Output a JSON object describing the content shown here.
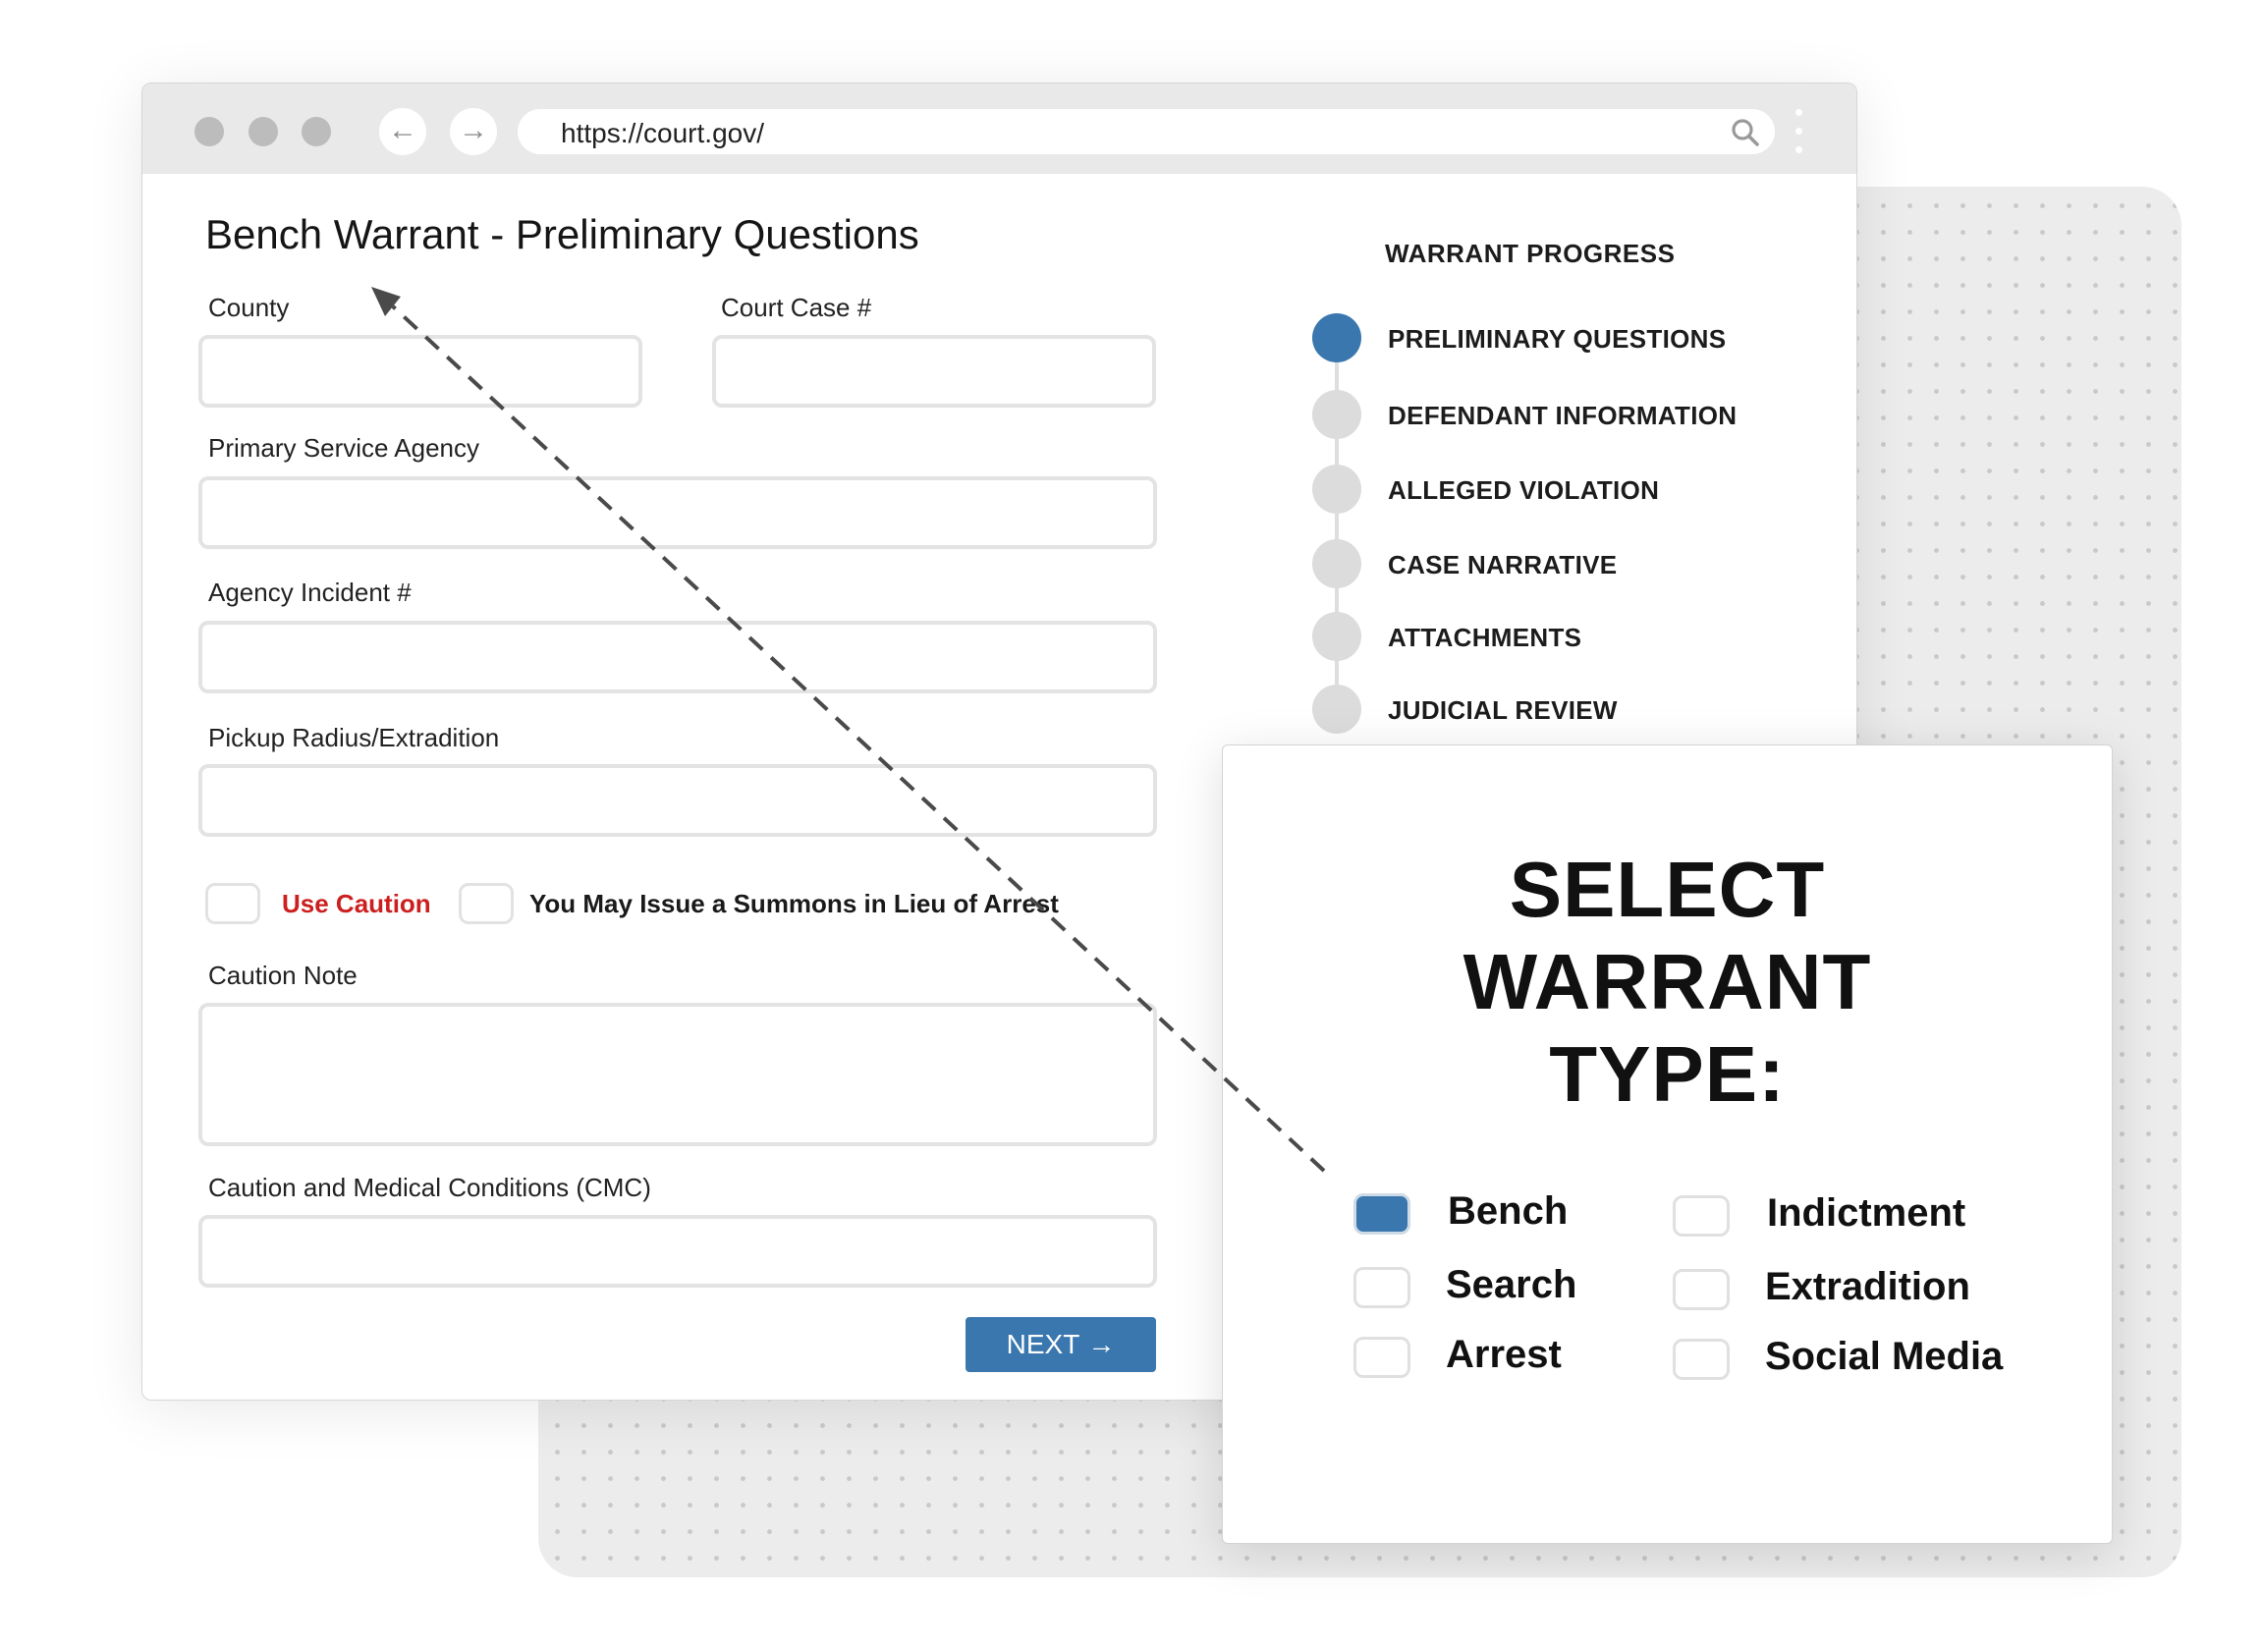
{
  "browser": {
    "url": "https://court.gov/",
    "back_icon": "arrow-left-icon",
    "forward_icon": "arrow-right-icon",
    "search_icon": "search-icon",
    "menu_icon": "kebab-menu-icon"
  },
  "form": {
    "title": "Bench Warrant - Preliminary Questions",
    "fields": {
      "county": {
        "label": "County",
        "value": ""
      },
      "court_case": {
        "label": "Court Case #",
        "value": ""
      },
      "primary_service_agency": {
        "label": "Primary Service Agency",
        "value": ""
      },
      "agency_incident": {
        "label": "Agency Incident #",
        "value": ""
      },
      "pickup_radius": {
        "label": "Pickup Radius/Extradition",
        "value": ""
      },
      "caution_note": {
        "label": "Caution Note",
        "value": ""
      },
      "cmc": {
        "label": "Caution and Medical Conditions (CMC)",
        "value": ""
      }
    },
    "checkboxes": {
      "use_caution": {
        "label": "Use Caution",
        "checked": false,
        "color": "#cc1f1f"
      },
      "summons": {
        "label": "You May Issue a Summons in Lieu of Arrest",
        "checked": false
      }
    },
    "next_button": {
      "label": "NEXT",
      "icon": "arrow-right-icon"
    }
  },
  "progress": {
    "title": "WARRANT PROGRESS",
    "steps": [
      {
        "label": "PRELIMINARY QUESTIONS",
        "active": true
      },
      {
        "label": "DEFENDANT INFORMATION",
        "active": false
      },
      {
        "label": "ALLEGED VIOLATION",
        "active": false
      },
      {
        "label": "CASE NARRATIVE",
        "active": false
      },
      {
        "label": "ATTACHMENTS",
        "active": false
      },
      {
        "label": "JUDICIAL REVIEW",
        "active": false
      }
    ]
  },
  "warrant_type": {
    "title_lines": [
      "SELECT",
      "WARRANT",
      "TYPE:"
    ],
    "options": [
      {
        "label": "Bench",
        "checked": true
      },
      {
        "label": "Search",
        "checked": false
      },
      {
        "label": "Arrest",
        "checked": false
      },
      {
        "label": "Indictment",
        "checked": false
      },
      {
        "label": "Extradition",
        "checked": false
      },
      {
        "label": "Social Media",
        "checked": false
      }
    ]
  },
  "colors": {
    "accent": "#3a77ae",
    "caution": "#cc1f1f",
    "field_border": "#e3e3e3",
    "inactive_step": "#dcdcdc"
  }
}
